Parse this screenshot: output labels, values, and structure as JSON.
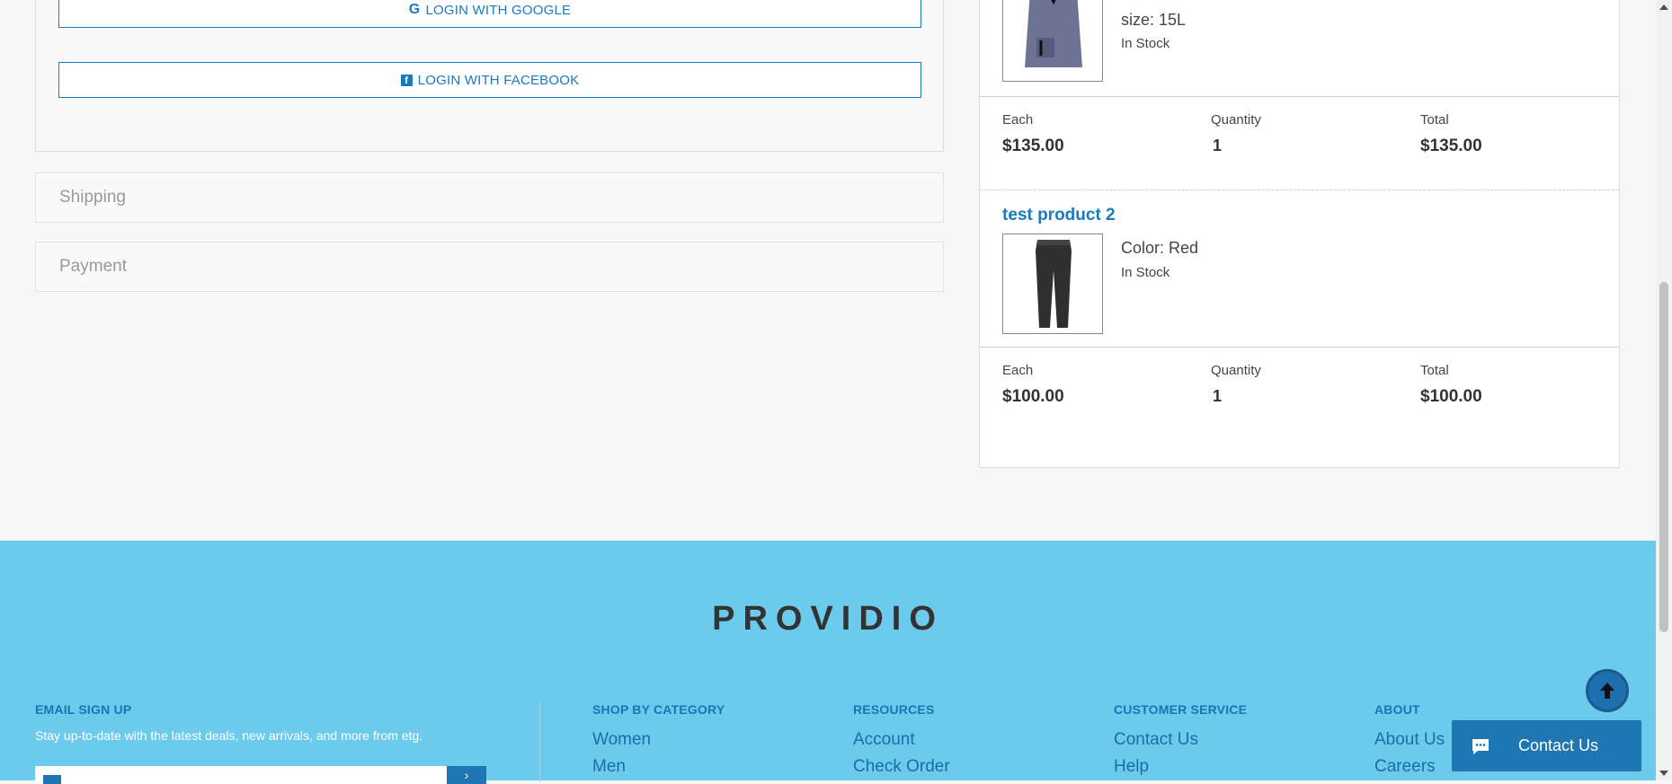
{
  "login": {
    "google_label": "LOGIN WITH GOOGLE",
    "facebook_label": "LOGIN WITH FACEBOOK"
  },
  "sections": {
    "shipping": "Shipping",
    "payment": "Payment"
  },
  "cart": {
    "items": [
      {
        "name": "",
        "size": "size: 15L",
        "stock": "In Stock",
        "each_label": "Each",
        "each": "$135.00",
        "qty_label": "Quantity",
        "qty": "1",
        "total_label": "Total",
        "total": "$135.00"
      },
      {
        "name": "test product 2",
        "color": "Color: Red",
        "stock": "In Stock",
        "each_label": "Each",
        "each": "$100.00",
        "qty_label": "Quantity",
        "qty": "1",
        "total_label": "Total",
        "total": "$100.00"
      }
    ]
  },
  "footer": {
    "brand": "PROVIDIO",
    "email_signup": {
      "title": "EMAIL SIGN UP",
      "note": "Stay up-to-date with the latest deals, new arrivals, and more from etg."
    },
    "columns": [
      {
        "title": "SHOP BY CATEGORY",
        "links": [
          "Women",
          "Men"
        ]
      },
      {
        "title": "RESOURCES",
        "links": [
          "Account",
          "Check Order"
        ]
      },
      {
        "title": "CUSTOMER SERVICE",
        "links": [
          "Contact Us",
          "Help"
        ]
      },
      {
        "title": "ABOUT",
        "links": [
          "About Us",
          "Careers"
        ]
      }
    ]
  },
  "widget": {
    "contact_label": "Contact Us"
  },
  "colors": {
    "accent": "#1a7bbf",
    "footer_bg": "#6ccaec",
    "widget_bg": "#1e77b3"
  },
  "icons": [
    "google-icon",
    "facebook-icon",
    "arrow-up-icon",
    "chat-icon",
    "mail-icon",
    "chevron-right-icon"
  ]
}
